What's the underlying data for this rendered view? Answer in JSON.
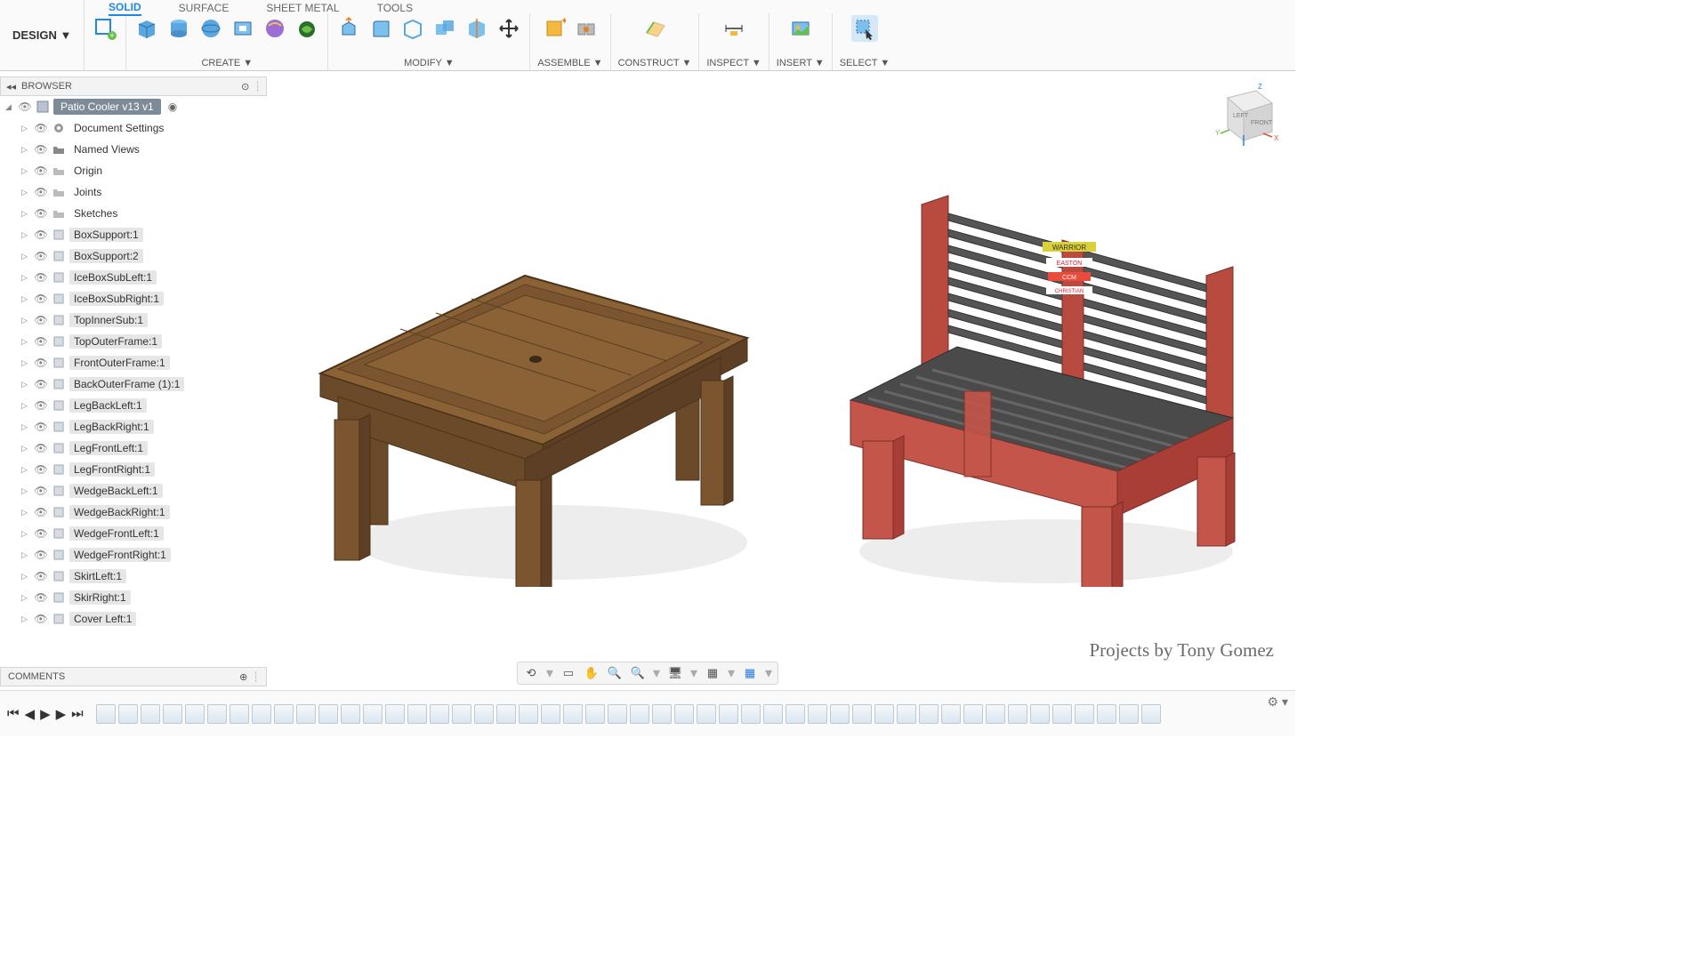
{
  "ribbon": {
    "design_label": "DESIGN ▼",
    "tabs": [
      "SOLID",
      "SURFACE",
      "SHEET METAL",
      "TOOLS"
    ],
    "active_tab": "SOLID",
    "groups": {
      "create": "CREATE ▼",
      "modify": "MODIFY ▼",
      "assemble": "ASSEMBLE ▼",
      "construct": "CONSTRUCT ▼",
      "inspect": "INSPECT ▼",
      "insert": "INSERT ▼",
      "select": "SELECT ▼"
    }
  },
  "browser": {
    "title": "BROWSER",
    "root": "Patio Cooler v13 v1",
    "items": [
      {
        "label": "Document Settings",
        "icon": "gear"
      },
      {
        "label": "Named Views",
        "icon": "folder"
      },
      {
        "label": "Origin",
        "icon": "folder-dim"
      },
      {
        "label": "Joints",
        "icon": "folder-dim"
      },
      {
        "label": "Sketches",
        "icon": "folder-dim"
      },
      {
        "label": "BoxSupport:1",
        "icon": "comp",
        "hl": true
      },
      {
        "label": "BoxSupport:2",
        "icon": "comp",
        "hl": true
      },
      {
        "label": "IceBoxSubLeft:1",
        "icon": "comp",
        "hl": true
      },
      {
        "label": "IceBoxSubRight:1",
        "icon": "comp",
        "hl": true
      },
      {
        "label": "TopInnerSub:1",
        "icon": "comp",
        "hl": true
      },
      {
        "label": "TopOuterFrame:1",
        "icon": "comp",
        "hl": true
      },
      {
        "label": "FrontOuterFrame:1",
        "icon": "comp",
        "hl": true
      },
      {
        "label": "BackOuterFrame (1):1",
        "icon": "comp",
        "hl": true
      },
      {
        "label": "LegBackLeft:1",
        "icon": "comp",
        "hl": true
      },
      {
        "label": "LegBackRight:1",
        "icon": "comp",
        "hl": true
      },
      {
        "label": "LegFrontLeft:1",
        "icon": "comp",
        "hl": true
      },
      {
        "label": "LegFrontRight:1",
        "icon": "comp",
        "hl": true
      },
      {
        "label": "WedgeBackLeft:1",
        "icon": "comp",
        "hl": true
      },
      {
        "label": "WedgeBackRight:1",
        "icon": "comp",
        "hl": true
      },
      {
        "label": "WedgeFrontLeft:1",
        "icon": "comp",
        "hl": true
      },
      {
        "label": "WedgeFrontRight:1",
        "icon": "comp",
        "hl": true
      },
      {
        "label": "SkirtLeft:1",
        "icon": "comp",
        "hl": true
      },
      {
        "label": "SkirRight:1",
        "icon": "comp",
        "hl": true
      },
      {
        "label": "Cover Left:1",
        "icon": "comp",
        "hl": true
      }
    ]
  },
  "comments_label": "COMMENTS",
  "viewcube": {
    "left": "LEFT",
    "front": "FRONT",
    "axis_z": "Z",
    "axis_y": "Y",
    "axis_x": "X"
  },
  "credit": "Projects by Tony Gomez",
  "bench_decals": [
    "WARRIOR",
    "EASTON",
    "CCM",
    "CHRISTIAN"
  ],
  "timeline_count": 48
}
